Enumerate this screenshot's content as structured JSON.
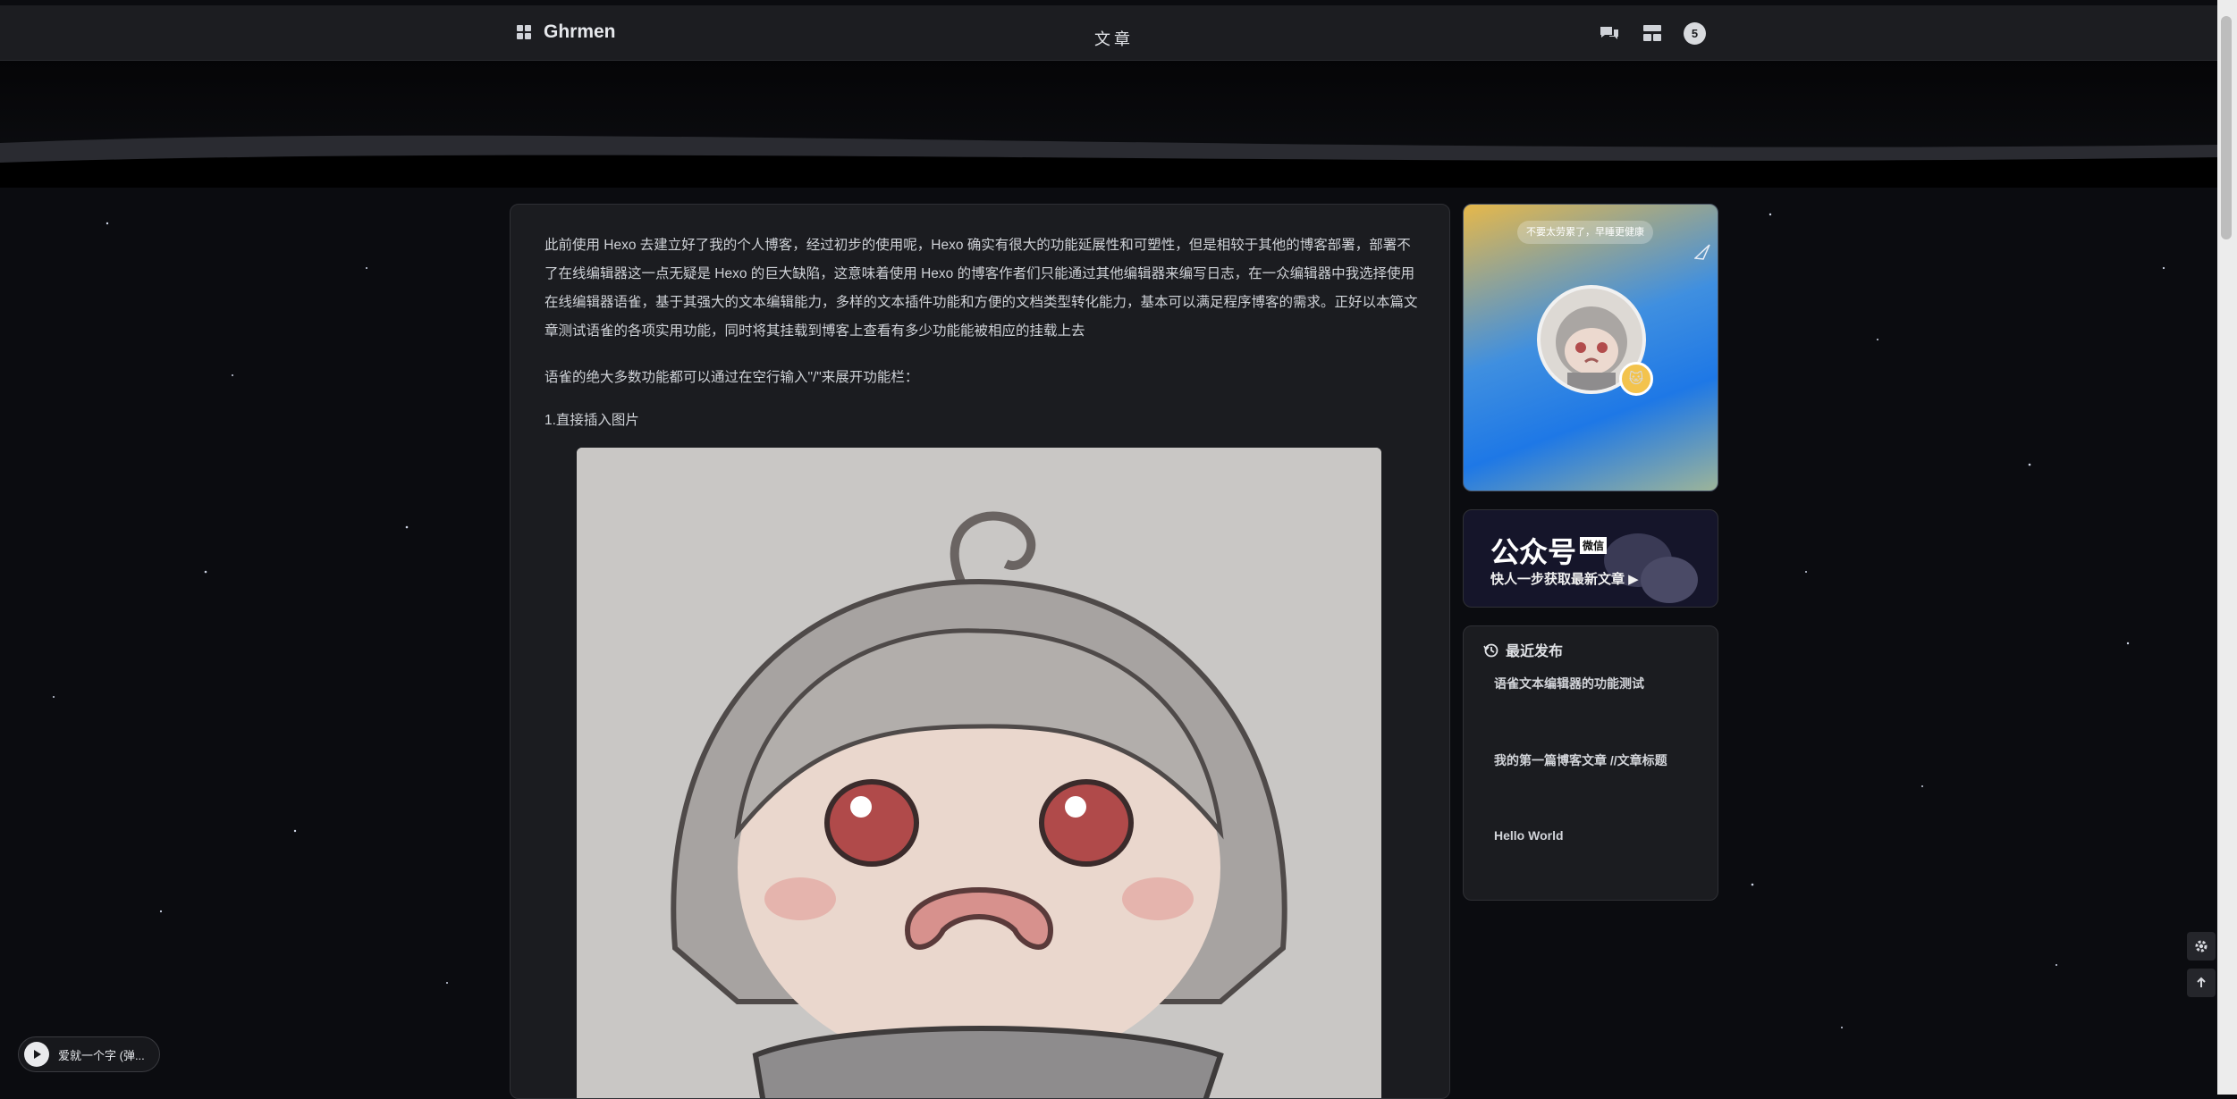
{
  "brand": {
    "name": "Ghrmen"
  },
  "nav": {
    "title": "文章",
    "notifications": "5"
  },
  "article": {
    "paragraphs": [
      "此前使用 Hexo 去建立好了我的个人博客，经过初步的使用呢，Hexo 确实有很大的功能延展性和可塑性，但是相较于其他的博客部署，部署不了在线编辑器这一点无疑是 Hexo 的巨大缺陷，这意味着使用 Hexo 的博客作者们只能通过其他编辑器来编写日志，在一众编辑器中我选择使用在线编辑器语雀，基于其强大的文本编辑能力，多样的文本插件功能和方便的文档类型转化能力，基本可以满足程序博客的需求。正好以本篇文章测试语雀的各项实用功能，同时将其挂载到博客上查看有多少功能能被相应的挂载上去",
      "语雀的绝大多数功能都可以通过在空行输入\"/\"来展开功能栏：",
      "1.直接插入图片"
    ]
  },
  "sidebar": {
    "profile": {
      "slogan": "不要太劳累了，早睡更健康"
    },
    "wechat": {
      "title": "公众号",
      "tag": "微信",
      "subtitle": "快人一步获取最新文章 ▶"
    },
    "recent": {
      "title": "最近发布",
      "items": [
        "语雀文本编辑器的功能测试",
        "我的第一篇博客文章 //文章标题",
        "Hello World"
      ]
    }
  },
  "music": {
    "label": "爱就一个字 (弹..."
  },
  "colors": {
    "background": "#0b0c10",
    "card": "#1b1c20",
    "topbar": "#1c1d21"
  }
}
